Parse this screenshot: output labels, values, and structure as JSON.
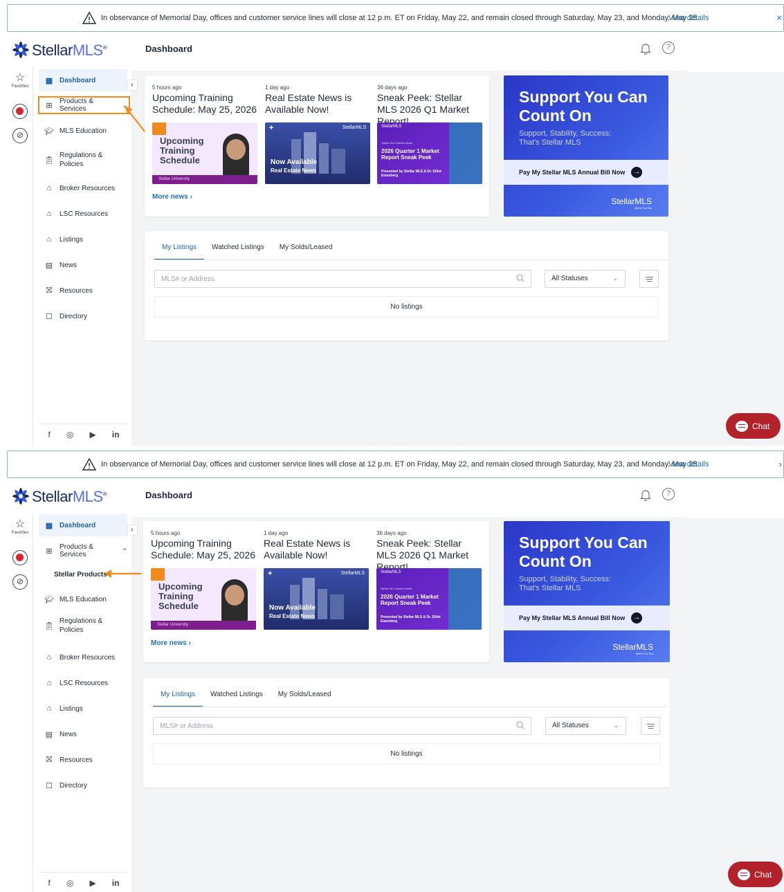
{
  "banner": {
    "message": "In observance of Memorial Day, offices and customer service lines will close at 12 p.m. ET on Friday, May 22, and remain closed through Saturday, May 23, and Monday, May 25.",
    "details_link": "View details",
    "close": "×"
  },
  "logo": {
    "name_a": "Stellar",
    "name_b": "MLS",
    "reg": "®"
  },
  "header": {
    "title": "Dashboard"
  },
  "rail": {
    "favorites_label": "Favorites"
  },
  "sidebar": {
    "items": [
      {
        "label": "Dashboard"
      },
      {
        "label": "Products & Services"
      },
      {
        "label": "MLS Education"
      },
      {
        "label": "Regulations & Policies"
      },
      {
        "label": "Broker Resources"
      },
      {
        "label": "LSC Resources"
      },
      {
        "label": "Listings"
      },
      {
        "label": "News"
      },
      {
        "label": "Resources"
      },
      {
        "label": "Directory"
      }
    ],
    "sub_item": "Stellar Products",
    "social": [
      "f",
      "◎",
      "▶",
      "in"
    ]
  },
  "news": {
    "items": [
      {
        "ago": "5 hours ago",
        "title": "Upcoming Training Schedule: May 25, 2026",
        "thumb_text": "Upcoming Training Schedule",
        "thumb_tag": "Stellar University"
      },
      {
        "ago": "1 day ago",
        "title": "Real Estate News is Available Now!",
        "thumb_text": "Now Available",
        "thumb_tag": "Real Estate News"
      },
      {
        "ago": "36 days ago",
        "title": "Sneak Peek: Stellar MLS 2026 Q1 Market Report!",
        "thumb_text": "2026 Quarter 1 Market Report Sneak Peek",
        "thumb_tag": "Presented by Stellar MLS & Dr. Elliot Eisenberg",
        "thumb_small": "Stellar MLS Market Meter"
      }
    ],
    "more": "More news"
  },
  "ad": {
    "headline": "Support You Can Count On",
    "sub": "Support, Stability, Success: That's Stellar MLS",
    "cta": "Pay My Stellar MLS Annual Bill Now",
    "mark": "StellarMLS",
    "tagline": "We're For You"
  },
  "listings": {
    "tabs": [
      "My Listings",
      "Watched Listings",
      "My Solds/Leased"
    ],
    "search_placeholder": "MLS# or Address",
    "status_value": "All Statuses",
    "empty": "No listings"
  },
  "chat": {
    "label": "Chat"
  },
  "colors": {
    "accent": "#1f5fa8",
    "highlight": "#f08a1c",
    "chat": "#b3222a",
    "ad": "#2b36c8"
  }
}
